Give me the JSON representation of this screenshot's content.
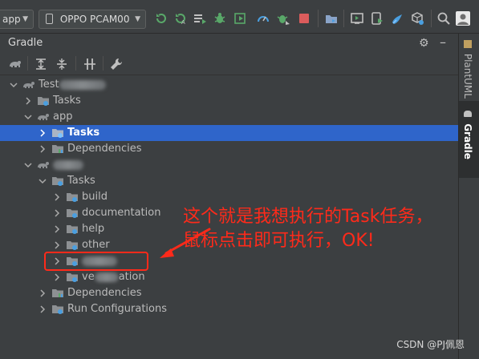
{
  "toolbar": {
    "module_combo": "app",
    "device_combo": "OPPO PCAM00"
  },
  "panel": {
    "title": "Gradle"
  },
  "side_tabs": {
    "plantuml": "PlantUML",
    "gradle": "Gradle"
  },
  "tree": {
    "root_label": "Test",
    "root_tasks": "Tasks",
    "app_label": "app",
    "app_tasks": "Tasks",
    "app_dependencies": "Dependencies",
    "module_tasks": "Tasks",
    "task_build": "build",
    "task_documentation": "documentation",
    "task_help": "help",
    "task_other": "other",
    "task_verification_prefix": "ve",
    "task_verification_suffix": "ation",
    "module_dependencies": "Dependencies",
    "module_run_configurations": "Run Configurations"
  },
  "annotation": {
    "line1": "这个就是我想执行的Task任务，",
    "line2": "鼠标点击即可执行，OK!"
  },
  "watermark": "CSDN @PJ佩恩",
  "colors": {
    "selection": "#2f65ca",
    "annotation_red": "#ff2a1a",
    "run_green": "#59a869",
    "stop_red": "#db5c5c"
  }
}
